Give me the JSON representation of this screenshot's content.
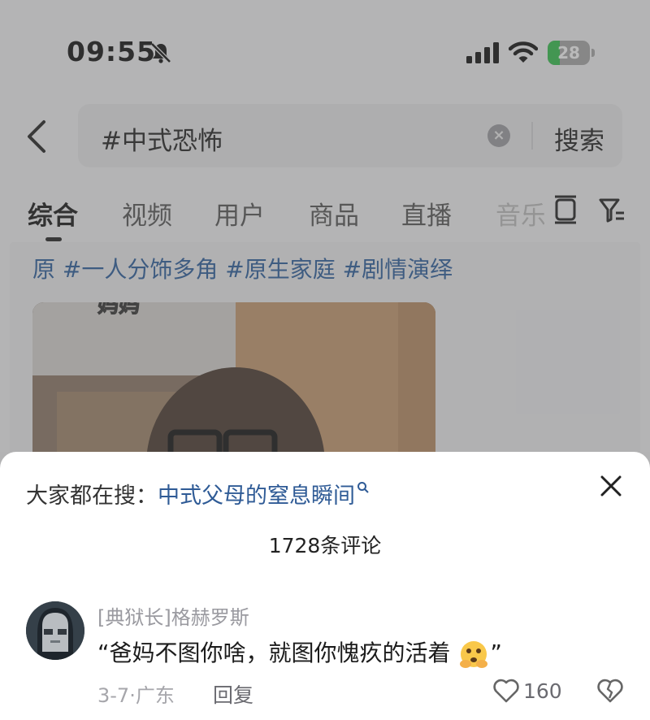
{
  "status_bar": {
    "time": "09:55",
    "battery": "28",
    "battery_level": 0.28
  },
  "search": {
    "query": "#中式恐怖",
    "button": "搜索"
  },
  "tabs": [
    "综合",
    "视频",
    "用户",
    "商品",
    "直播",
    "音乐"
  ],
  "result": {
    "tags": "原 #一人分饰多角 #原生家庭 #剧情演绎",
    "video_caption": "妈妈"
  },
  "sheet": {
    "trending_prefix": "大家都在搜：",
    "trending_link": "中式父母的窒息瞬间",
    "comment_count": "1728条评论",
    "comments": [
      {
        "username": "[典狱长]格赫罗斯",
        "text": "“爸妈不图你啥，就图你愧疚的活着",
        "text_end": "”",
        "date_location": "3-7·广东",
        "reply": "回复",
        "likes": "160"
      }
    ]
  },
  "colors": {
    "link": "#2f5b96",
    "battery_fill": "#33c24d"
  }
}
